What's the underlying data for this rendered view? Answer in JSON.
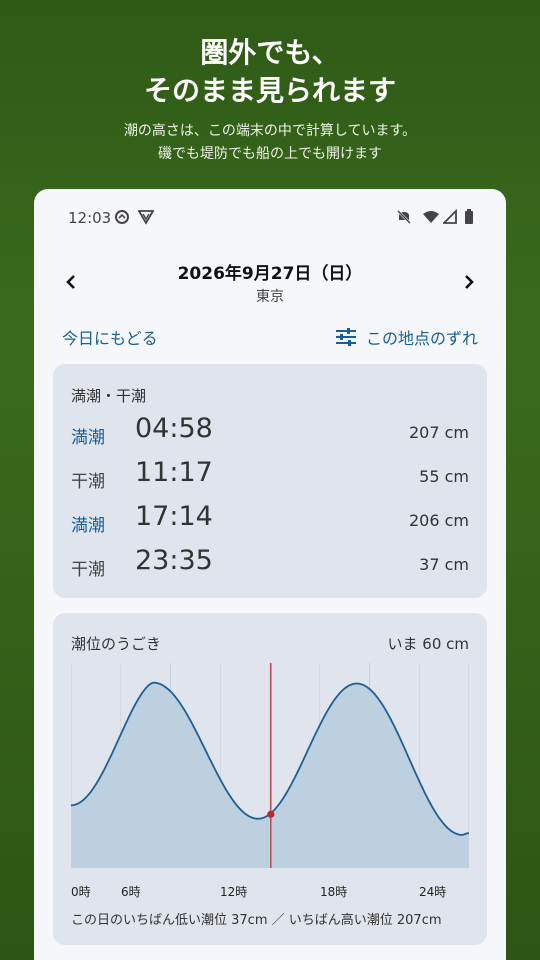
{
  "promo": {
    "title_line1": "圏外でも、",
    "title_line2": "そのまま見られます",
    "sub_line1": "潮の高さは、この端末の中で計算しています。",
    "sub_line2": "磯でも堤防でも船の上でも開けます"
  },
  "status_bar": {
    "time": "12:03",
    "icons": [
      "sync-icon",
      "shield-v-icon",
      "mute-icon",
      "wifi-icon",
      "signal-icon",
      "battery-icon"
    ]
  },
  "header": {
    "date": "2026年9月27日（日）",
    "place": "東京",
    "prev_icon": "chevron-left-icon",
    "next_icon": "chevron-right-icon"
  },
  "links": {
    "today": "今日にもどる",
    "offset": "この地点のずれ",
    "offset_icon": "sliders-icon"
  },
  "tides": {
    "label": "満潮・干潮",
    "rows": [
      {
        "kind": "満潮",
        "type": "high",
        "time": "04:58",
        "height": "207 cm"
      },
      {
        "kind": "干潮",
        "type": "low",
        "time": "11:17",
        "height": "55 cm"
      },
      {
        "kind": "満潮",
        "type": "high",
        "time": "17:14",
        "height": "206 cm"
      },
      {
        "kind": "干潮",
        "type": "low",
        "time": "23:35",
        "height": "37 cm"
      }
    ]
  },
  "chart": {
    "label": "潮位のうごき",
    "now_text": "いま 60 cm",
    "ticks": [
      "0時",
      "6時",
      "12時",
      "18時",
      "24時"
    ],
    "note": "この日のいちばん低い潮位 37cm ／ いちばん高い潮位 207cm",
    "colors": {
      "line": "#1f5f96",
      "fill": "#bdd0e0",
      "now": "#c0292b",
      "grid": "#c8ced8"
    }
  },
  "chart_data": {
    "type": "area",
    "x_unit": "hour",
    "x": [
      0,
      4.97,
      11.28,
      17.23,
      23.58,
      24
    ],
    "y": [
      55,
      207,
      55,
      206,
      37,
      39
    ],
    "x_ticks": [
      0,
      6,
      12,
      18,
      24
    ],
    "xlim": [
      0,
      24
    ],
    "ylim": [
      0,
      220
    ],
    "now_hour": 12.05,
    "now_value": 60,
    "grid": true
  }
}
